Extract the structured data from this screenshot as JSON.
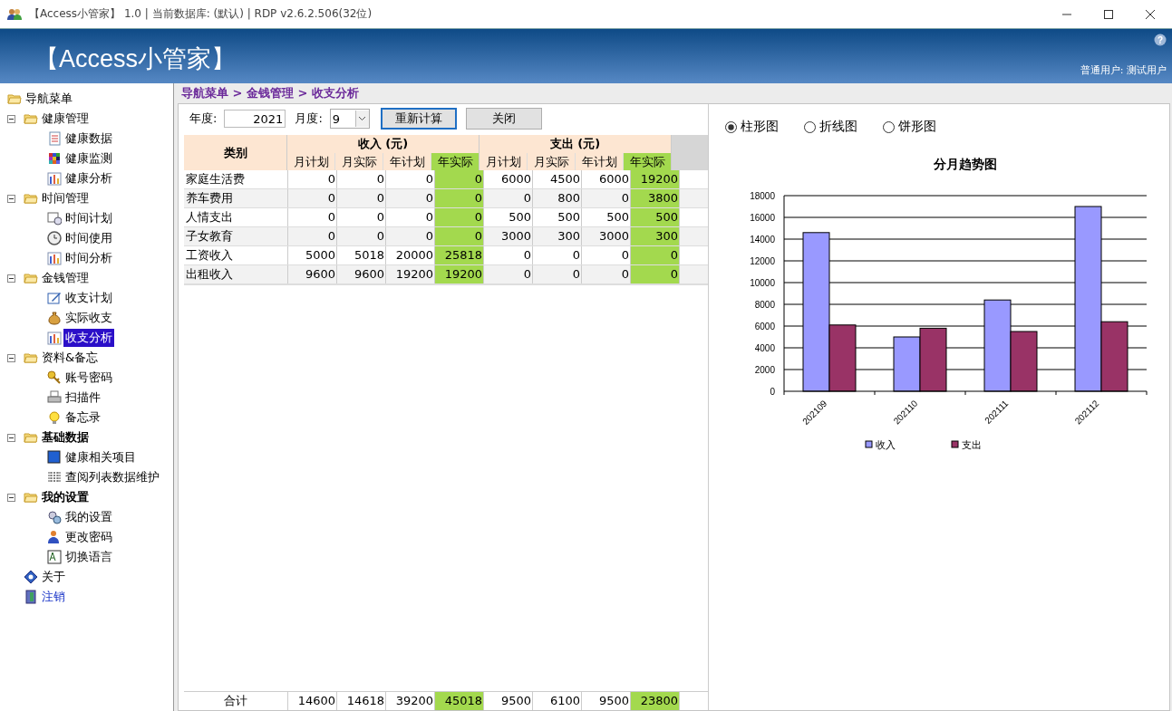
{
  "window": {
    "title": "【Access小管家】 1.0 | 当前数据库: (默认) | RDP v2.6.2.506(32位)"
  },
  "banner": {
    "title": "【Access小管家】",
    "help": "?",
    "user": "普通用户: 测试用户"
  },
  "sidebar": {
    "items": [
      {
        "label": "导航菜单",
        "kind": "folder",
        "selected": false,
        "children": [
          {
            "label": "健康管理",
            "kind": "folder",
            "selected": false,
            "expanded": true,
            "children": [
              {
                "label": "健康数据",
                "kind": "doc",
                "selected": false
              },
              {
                "label": "健康监测",
                "kind": "grid",
                "selected": false
              },
              {
                "label": "健康分析",
                "kind": "chart",
                "selected": false
              }
            ]
          },
          {
            "label": "时间管理",
            "kind": "folder",
            "selected": false,
            "expanded": true,
            "children": [
              {
                "label": "时间计划",
                "kind": "calendar",
                "selected": false
              },
              {
                "label": "时间使用",
                "kind": "clock",
                "selected": false
              },
              {
                "label": "时间分析",
                "kind": "chart",
                "selected": false
              }
            ]
          },
          {
            "label": "金钱管理",
            "kind": "folder",
            "selected": false,
            "expanded": true,
            "children": [
              {
                "label": "收支计划",
                "kind": "edit",
                "selected": false
              },
              {
                "label": "实际收支",
                "kind": "bag",
                "selected": false
              },
              {
                "label": "收支分析",
                "kind": "chart",
                "selected": true
              }
            ]
          },
          {
            "label": "资料&备忘",
            "kind": "folder",
            "selected": false,
            "expanded": true,
            "children": [
              {
                "label": "账号密码",
                "kind": "key",
                "selected": false
              },
              {
                "label": "扫描件",
                "kind": "printer",
                "selected": false
              },
              {
                "label": "备忘录",
                "kind": "bulb",
                "selected": false
              }
            ]
          },
          {
            "label": "基础数据",
            "kind": "section",
            "selected": false,
            "expanded": true,
            "children": [
              {
                "label": "健康相关项目",
                "kind": "project",
                "selected": false
              },
              {
                "label": "查阅列表数据维护",
                "kind": "table",
                "selected": false
              }
            ]
          },
          {
            "label": "我的设置",
            "kind": "section",
            "selected": false,
            "expanded": true,
            "children": [
              {
                "label": "我的设置",
                "kind": "gear",
                "selected": false
              },
              {
                "label": "更改密码",
                "kind": "user",
                "selected": false
              },
              {
                "label": "切换语言",
                "kind": "text",
                "selected": false
              }
            ]
          },
          {
            "label": "关于",
            "kind": "info",
            "selected": false
          },
          {
            "label": "注销",
            "kind": "logout",
            "selected": false
          }
        ]
      }
    ]
  },
  "breadcrumb": "导航菜单 > 金钱管理 > 收支分析",
  "toolbar": {
    "year_label": "年度:",
    "year": "2021",
    "month_label": "月度:",
    "month": "9",
    "buttons": [
      {
        "label": "重新计算",
        "focused": true
      },
      {
        "label": "关闭",
        "focused": false
      }
    ]
  },
  "table": {
    "category_header": "类别",
    "groups": [
      {
        "label": "收入 (元)",
        "columns": [
          {
            "label": "月计划",
            "highlighted": false
          },
          {
            "label": "月实际",
            "highlighted": false
          },
          {
            "label": "年计划",
            "highlighted": false
          },
          {
            "label": "年实际",
            "highlighted": true
          }
        ]
      },
      {
        "label": "支出 (元)",
        "columns": [
          {
            "label": "月计划",
            "highlighted": false
          },
          {
            "label": "月实际",
            "highlighted": false
          },
          {
            "label": "年计划",
            "highlighted": false
          },
          {
            "label": "年实际",
            "highlighted": true
          }
        ]
      }
    ],
    "rows": [
      {
        "category": "家庭生活费",
        "values": [
          "0",
          "0",
          "0",
          "0",
          "6000",
          "4500",
          "6000",
          "19200"
        ]
      },
      {
        "category": "养车费用",
        "values": [
          "0",
          "0",
          "0",
          "0",
          "0",
          "800",
          "0",
          "3800"
        ]
      },
      {
        "category": "人情支出",
        "values": [
          "0",
          "0",
          "0",
          "0",
          "500",
          "500",
          "500",
          "500"
        ]
      },
      {
        "category": "子女教育",
        "values": [
          "0",
          "0",
          "0",
          "0",
          "3000",
          "300",
          "3000",
          "300"
        ]
      },
      {
        "category": "工资收入",
        "values": [
          "5000",
          "5018",
          "20000",
          "25818",
          "0",
          "0",
          "0",
          "0"
        ]
      },
      {
        "category": "出租收入",
        "values": [
          "9600",
          "9600",
          "19200",
          "19200",
          "0",
          "0",
          "0",
          "0"
        ]
      }
    ],
    "total": {
      "label": "合计",
      "values": [
        "14600",
        "14618",
        "39200",
        "45018",
        "9500",
        "6100",
        "9500",
        "23800"
      ]
    }
  },
  "chart_types": [
    {
      "label": "柱形图",
      "selected": true
    },
    {
      "label": "折线图",
      "selected": false
    },
    {
      "label": "饼形图",
      "selected": false
    }
  ],
  "chart": {
    "chart_data": {
      "type": "bar",
      "title": "分月趋势图",
      "categories": [
        "202109",
        "202110",
        "202111",
        "202112"
      ],
      "series": [
        {
          "name": "收入",
          "color": "#9999ff",
          "values": [
            14600,
            5000,
            8400,
            17000
          ]
        },
        {
          "name": "支出",
          "color": "#993366",
          "values": [
            6100,
            5800,
            5500,
            6400
          ]
        }
      ],
      "ylim": [
        0,
        18000
      ],
      "yticks": [
        0,
        2000,
        4000,
        6000,
        8000,
        10000,
        12000,
        14000,
        16000,
        18000
      ],
      "grid": true,
      "legend": true
    }
  }
}
